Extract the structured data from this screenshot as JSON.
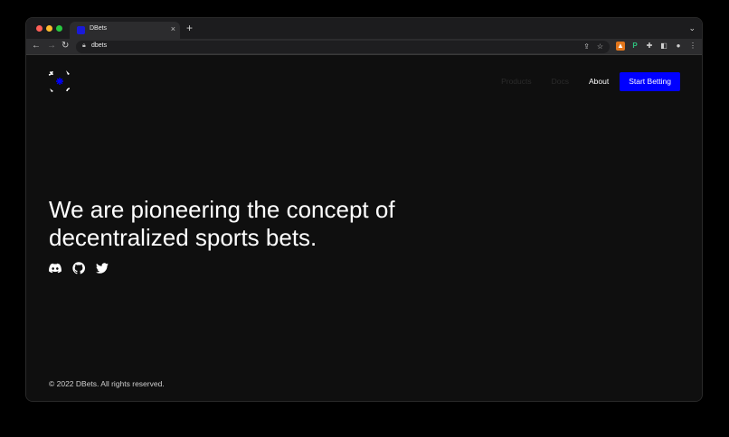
{
  "browser": {
    "tab_title": "DBets",
    "tab_close": "×",
    "new_tab": "+",
    "tab_menu": "⌄",
    "url": "dbets"
  },
  "nav": {
    "products": "Products",
    "docs": "Docs",
    "about": "About",
    "cta": "Start Betting"
  },
  "hero": {
    "line1": "We are pioneering the concept of",
    "line2": "decentralized sports bets."
  },
  "socials": [
    "discord-icon",
    "github-icon",
    "twitter-icon"
  ],
  "footer": {
    "copyright": "© 2022 DBets. All rights reserved."
  },
  "colors": {
    "page_bg": "#0f0f0f",
    "accent": "#0000ff",
    "text": "#ffffff",
    "muted_nav": "#2b2b2b"
  }
}
